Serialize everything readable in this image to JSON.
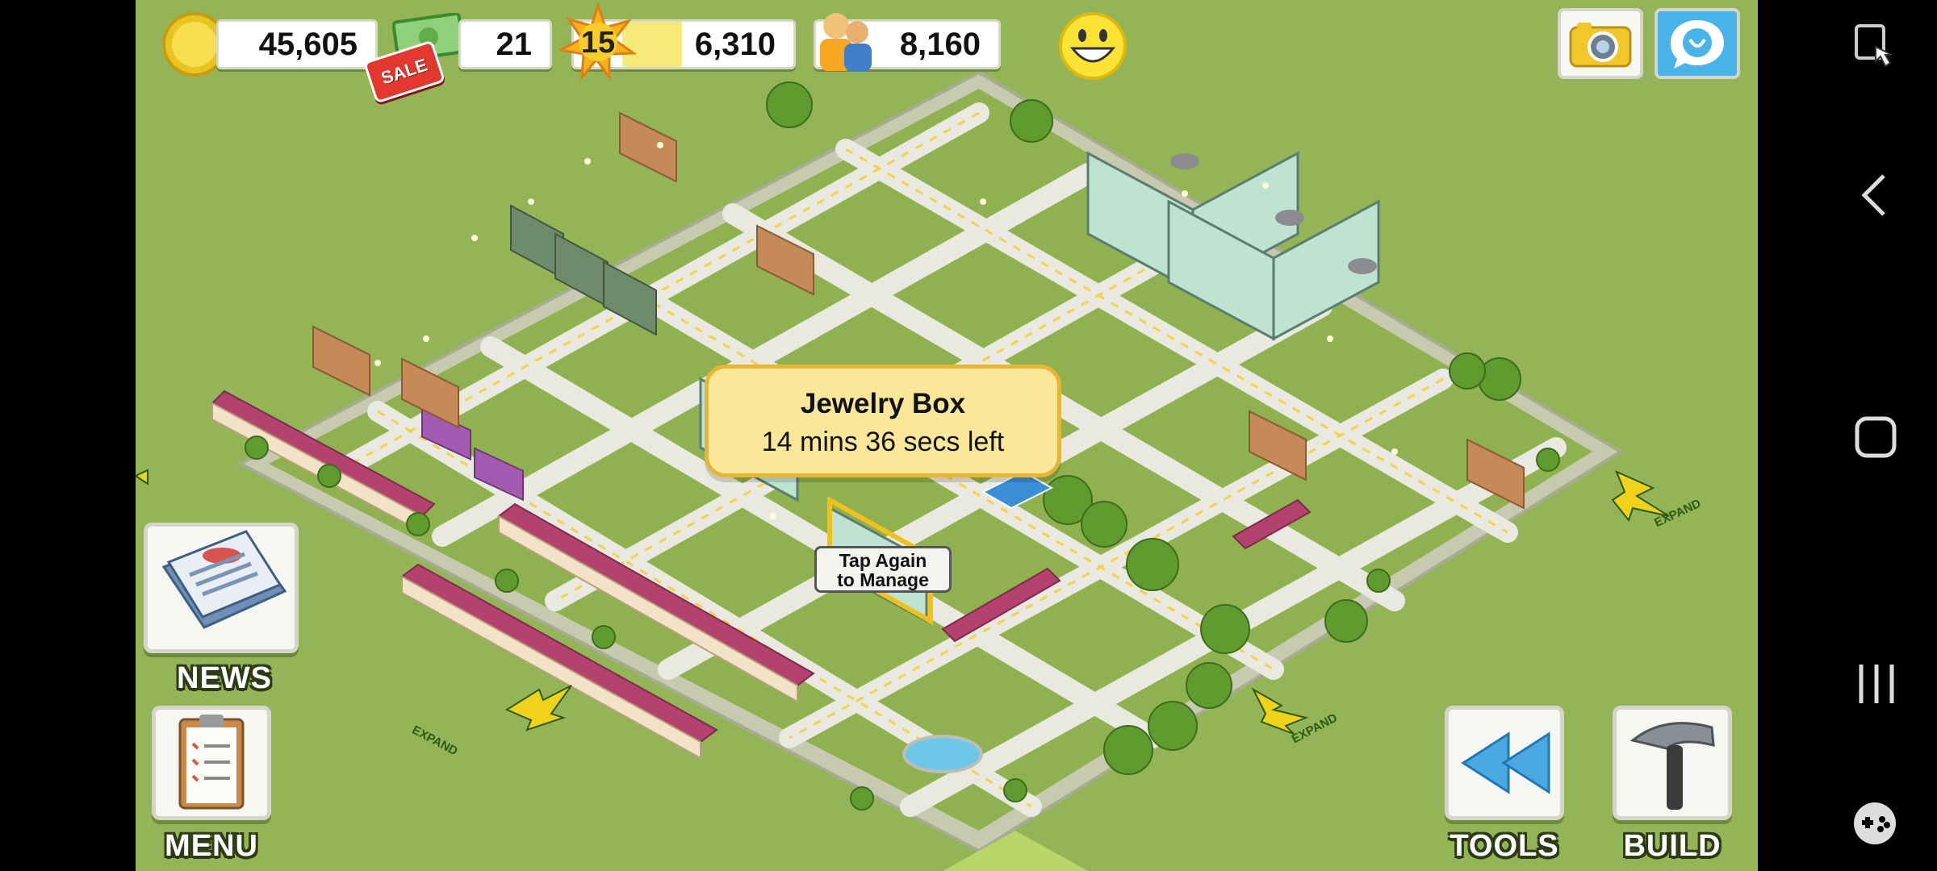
{
  "hud": {
    "coins": "45,605",
    "cash": "21",
    "sale_badge": "SALE",
    "level": "15",
    "xp": "6,310",
    "xp_progress": 0.35,
    "population": "8,160",
    "happiness_icon": "smiley-face-icon"
  },
  "top_right": {
    "camera_icon": "camera-icon",
    "social_icon": "social-share-icon"
  },
  "tooltip": {
    "title": "Jewelry Box",
    "time_left": "14 mins 36 secs left"
  },
  "selection": {
    "tap_line1": "Tap Again",
    "tap_line2": "to Manage"
  },
  "buttons": {
    "news": "NEWS",
    "menu": "MENU",
    "tools": "TOOLS",
    "build": "BUILD"
  },
  "expand_arrows": {
    "label": "EXPAND"
  },
  "system_nav": {
    "back_icon": "back-icon",
    "home_icon": "home-icon",
    "recents_icon": "recents-icon",
    "game_tools_icon": "gamepad-icon",
    "screen_lock_icon": "screen-lock-icon"
  },
  "colors": {
    "grass": "#93b457",
    "road": "#e6e6dc",
    "accent_gold": "#e6b534"
  }
}
